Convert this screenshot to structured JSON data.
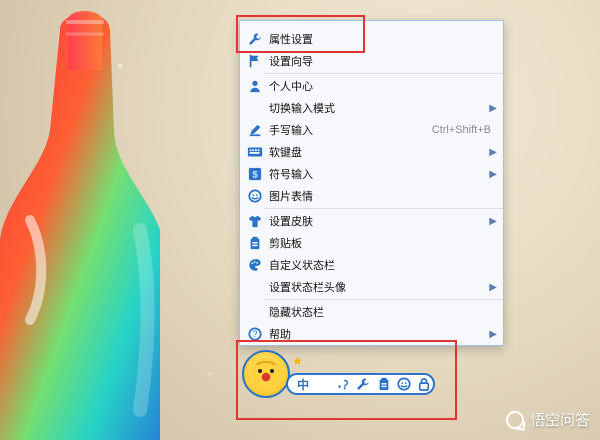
{
  "menu": {
    "items": [
      {
        "label": "属性设置",
        "icon": "wrench-icon",
        "has_submenu": false,
        "shortcut": ""
      },
      {
        "label": "设置向导",
        "icon": "flag-icon",
        "has_submenu": false,
        "shortcut": ""
      },
      {
        "label": "个人中心",
        "icon": "user-icon",
        "has_submenu": false,
        "shortcut": ""
      },
      {
        "label": "切换输入模式",
        "icon": "",
        "has_submenu": true,
        "shortcut": ""
      },
      {
        "label": "手写输入",
        "icon": "pen-icon",
        "has_submenu": false,
        "shortcut": "Ctrl+Shift+B"
      },
      {
        "label": "软键盘",
        "icon": "keyboard-icon",
        "has_submenu": true,
        "shortcut": ""
      },
      {
        "label": "符号输入",
        "icon": "dollar-icon",
        "has_submenu": true,
        "shortcut": ""
      },
      {
        "label": "图片表情",
        "icon": "smile-icon",
        "has_submenu": false,
        "shortcut": ""
      },
      {
        "label": "设置皮肤",
        "icon": "shirt-icon",
        "has_submenu": true,
        "shortcut": ""
      },
      {
        "label": "剪贴板",
        "icon": "clipboard-icon",
        "has_submenu": false,
        "shortcut": ""
      },
      {
        "label": "自定义状态栏",
        "icon": "palette-icon",
        "has_submenu": false,
        "shortcut": ""
      },
      {
        "label": "设置状态栏头像",
        "icon": "",
        "has_submenu": true,
        "shortcut": ""
      },
      {
        "label": "隐藏状态栏",
        "icon": "",
        "has_submenu": false,
        "shortcut": ""
      },
      {
        "label": "帮助",
        "icon": "help-icon",
        "has_submenu": true,
        "shortcut": ""
      }
    ]
  },
  "statusbar": {
    "mode_label": "中",
    "icons": [
      "moon-icon",
      "punctuation-icon",
      "wrench-icon",
      "clipboard-icon",
      "smile-icon",
      "lock-icon"
    ]
  },
  "watermark": {
    "text": "悟空问答"
  },
  "colors": {
    "accent": "#2a73c9",
    "highlight": "#e13535"
  }
}
